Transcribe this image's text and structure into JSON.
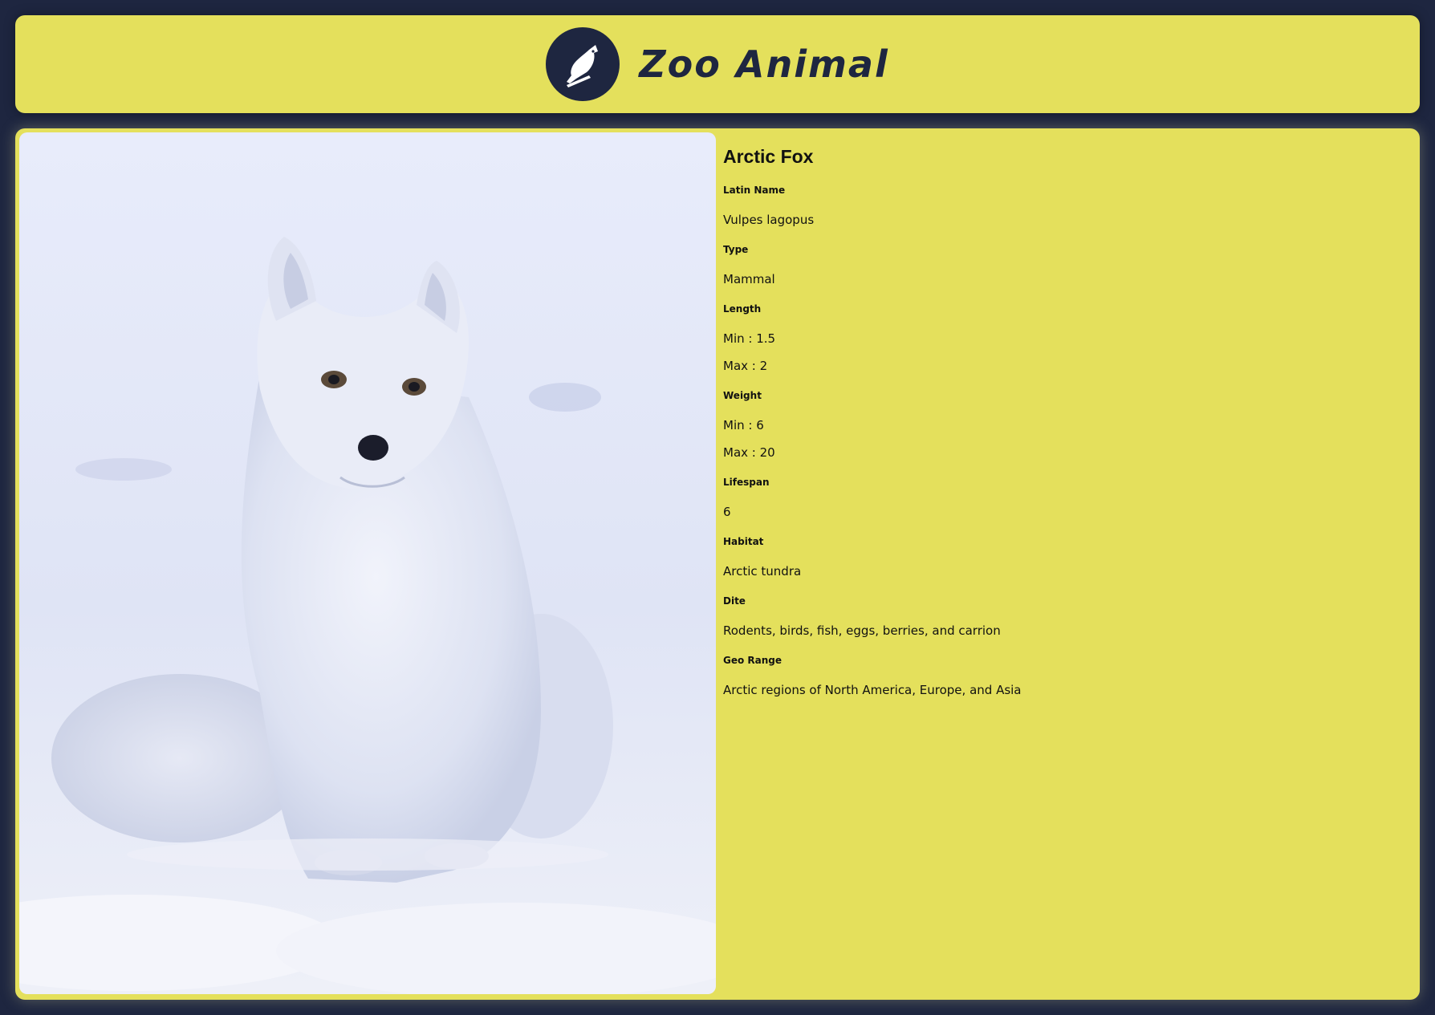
{
  "header": {
    "site_title": "Zoo Animal",
    "logo_icon": "bird-icon",
    "background_color": "#e4e05c",
    "text_color": "#1e2640"
  },
  "animal": {
    "name": "Arctic Fox",
    "image_description_icon": "arctic-fox-photo",
    "latin_name_label": "Latin Name",
    "latin_name": "Vulpes lagopus",
    "type_label": "Type",
    "type": "Mammal",
    "length_label": "Length",
    "length_min": "Min : 1.5",
    "length_max": "Max : 2",
    "weight_label": "Weight",
    "weight_min": "Min : 6",
    "weight_max": "Max : 20",
    "lifespan_label": "Lifespan",
    "lifespan": "6",
    "habitat_label": "Habitat",
    "habitat": "Arctic tundra",
    "diet_label": "Dite",
    "diet": "Rodents, birds, fish, eggs, berries, and carrion",
    "geo_range_label": "Geo Range",
    "geo_range": "Arctic regions of North America, Europe, and Asia"
  },
  "colors": {
    "page_background": "#1e2640",
    "card_background": "#e4e05c"
  }
}
